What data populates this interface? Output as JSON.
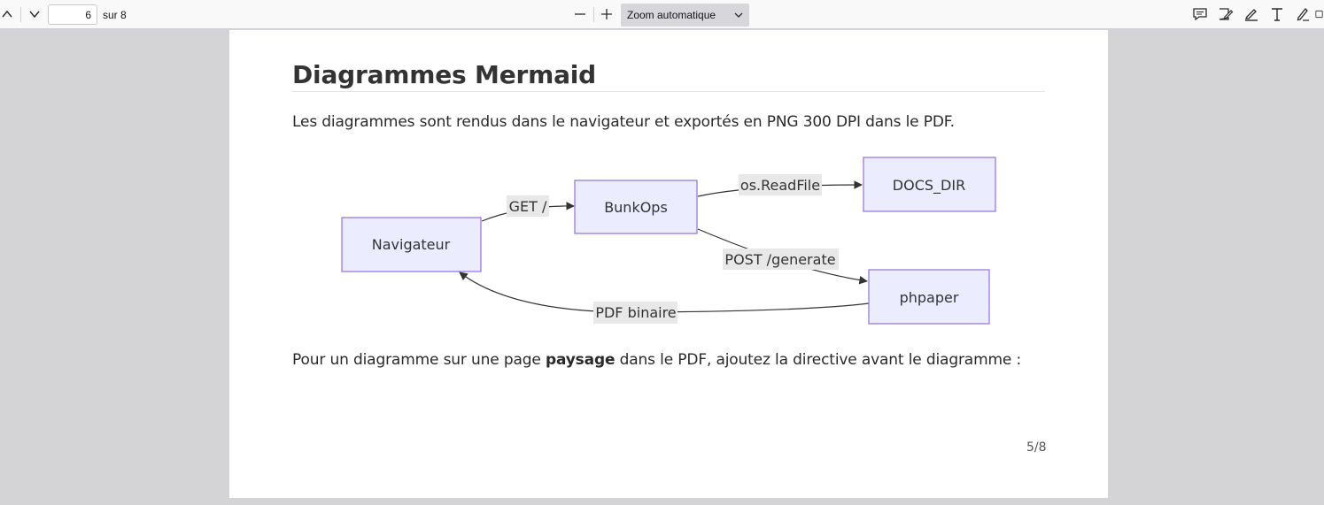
{
  "toolbar": {
    "page_current": "6",
    "page_of": "sur 8",
    "zoom_label": "Zoom automatique",
    "icons": [
      "chevron-up-icon",
      "chevron-down-icon",
      "minus-icon",
      "plus-icon",
      "comment-icon",
      "signature-icon",
      "highlight-icon",
      "text-icon",
      "draw-icon"
    ]
  },
  "document": {
    "heading": "Diagrammes Mermaid",
    "intro": "Les diagrammes sont rendus dans le navigateur et exportés en PNG 300 DPI dans le PDF.",
    "outro_before": "Pour un diagramme sur une page ",
    "outro_bold": "paysage",
    "outro_after": " dans le PDF, ajoutez la directive avant le diagramme :",
    "page_number": "5/8"
  },
  "diagram": {
    "nodes": {
      "navigateur": "Navigateur",
      "bunkops": "BunkOps",
      "docs_dir": "DOCS_DIR",
      "phpaper": "phpaper"
    },
    "edges": {
      "get": "GET /",
      "readfile": "os.ReadFile",
      "post": "POST /generate",
      "pdf": "PDF binaire"
    },
    "colors": {
      "node_fill": "#ececff",
      "node_stroke": "#9370db",
      "label_bg": "#e8e8e8"
    }
  }
}
